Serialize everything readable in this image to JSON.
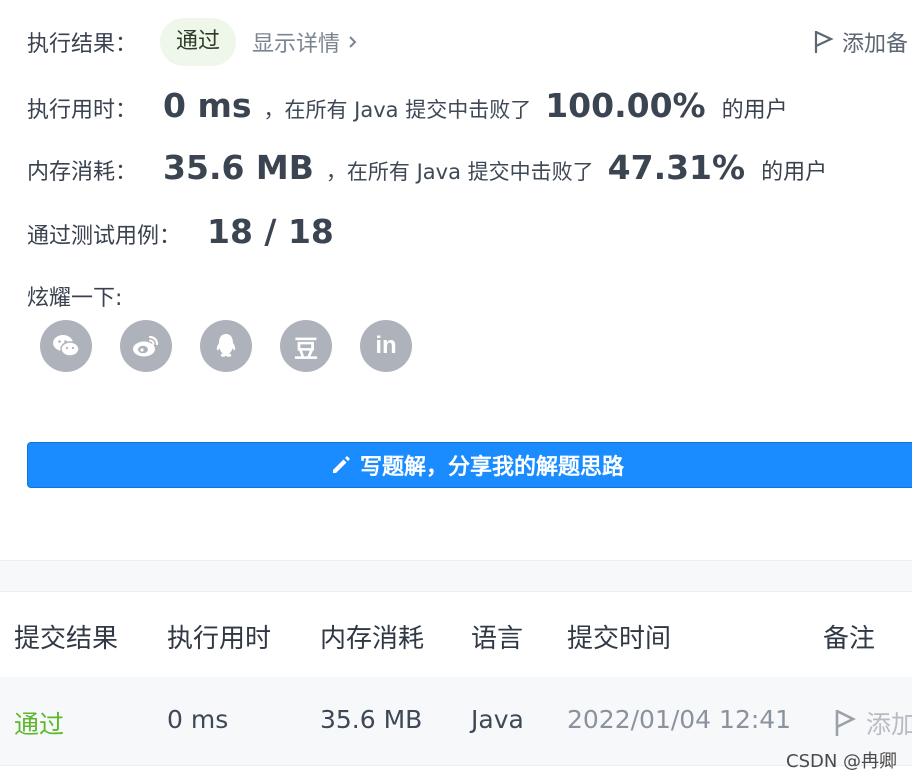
{
  "result": {
    "label": "执行结果：",
    "badge": "通过",
    "details": "显示详情",
    "add_note": "添加备"
  },
  "runtime": {
    "label": "执行用时：",
    "value": "0 ms",
    "mid": "，在所有 Java 提交中击败了",
    "percent": "100.00%",
    "suffix": "的用户"
  },
  "memory": {
    "label": "内存消耗：",
    "value": "35.6 MB",
    "mid": "，在所有 Java 提交中击败了",
    "percent": "47.31%",
    "suffix": "的用户"
  },
  "tests": {
    "label": "通过测试用例：",
    "value": "18 / 18"
  },
  "share": {
    "label": "炫耀一下:",
    "icons": [
      "wechat-icon",
      "weibo-icon",
      "qq-icon",
      "douban-icon",
      "linkedin-icon"
    ],
    "douban_text": "豆",
    "linkedin_text": "in"
  },
  "write_button": "写题解，分享我的解题思路",
  "table": {
    "headers": [
      "提交结果",
      "执行用时",
      "内存消耗",
      "语言",
      "提交时间",
      "备注"
    ],
    "rows": [
      {
        "status": "通过",
        "runtime": "0 ms",
        "memory": "35.6 MB",
        "language": "Java",
        "time": "2022/01/04 12:41",
        "note": "添加"
      }
    ]
  },
  "watermark": "CSDN @冉卿",
  "colors": {
    "accent": "#1a8cff",
    "pass_green": "#5cb82e",
    "badge_bg": "#eef7e9",
    "icon_gray": "#aeb3bb"
  }
}
